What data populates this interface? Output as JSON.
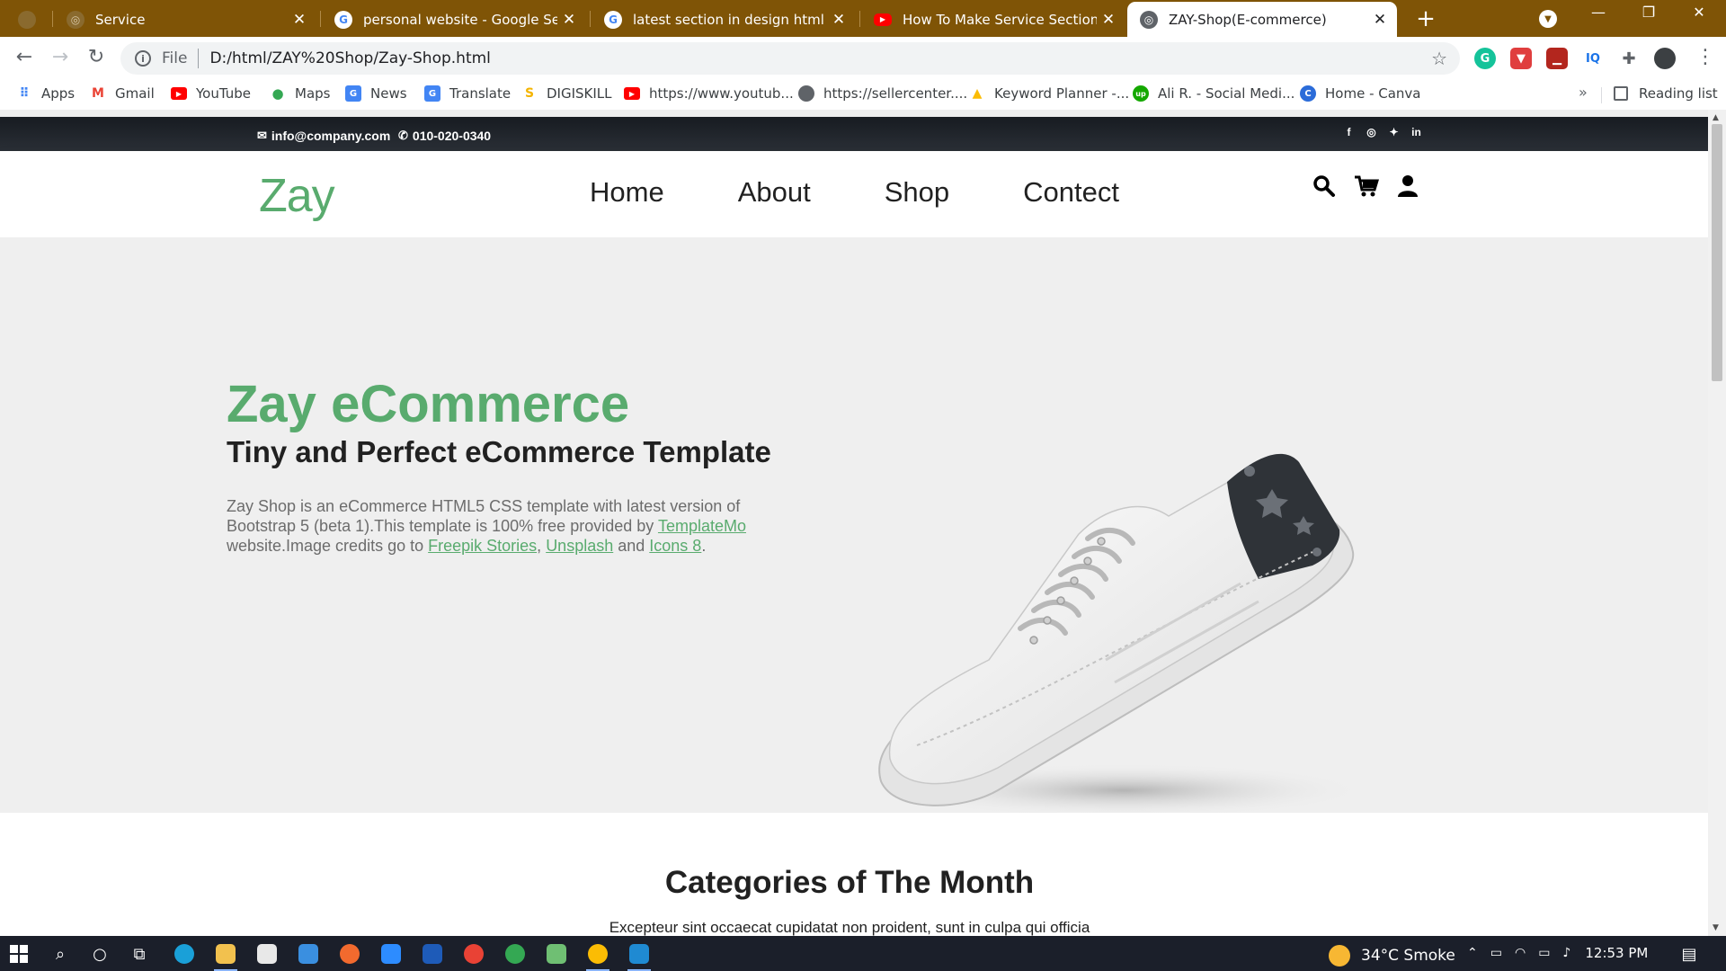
{
  "browser": {
    "tabs": [
      {
        "title": "Service",
        "icon": "globe-icon",
        "active": false
      },
      {
        "title": "personal website - Google Search",
        "icon": "google-icon",
        "active": false
      },
      {
        "title": "latest section in design html css",
        "icon": "google-icon",
        "active": false
      },
      {
        "title": "How To Make Service Section For",
        "icon": "youtube-icon",
        "active": false
      },
      {
        "title": "ZAY-Shop(E-commerce)",
        "icon": "globe-icon",
        "active": true
      }
    ],
    "address": {
      "scheme": "File",
      "url": "D:/html/ZAY%20Shop/Zay-Shop.html"
    },
    "bookmarks": [
      {
        "label": "Apps",
        "icon": "apps-grid-icon",
        "color": "#4285f4"
      },
      {
        "label": "Gmail",
        "icon": "gmail-icon",
        "color": "#ea4335"
      },
      {
        "label": "YouTube",
        "icon": "youtube-icon",
        "color": "#ff0000"
      },
      {
        "label": "Maps",
        "icon": "maps-pin-icon",
        "color": "#34a853"
      },
      {
        "label": "News",
        "icon": "news-icon",
        "color": "#4285f4"
      },
      {
        "label": "Translate",
        "icon": "translate-icon",
        "color": "#4285f4"
      },
      {
        "label": "DIGISKILL",
        "icon": "digiskill-icon",
        "color": "#f4b400"
      },
      {
        "label": "https://www.youtub...",
        "icon": "youtube-icon",
        "color": "#ff0000"
      },
      {
        "label": "https://sellercenter....",
        "icon": "globe-icon",
        "color": "#5f6368"
      },
      {
        "label": "Keyword Planner -...",
        "icon": "google-ads-icon",
        "color": "#fbbc04"
      },
      {
        "label": "Ali R. - Social Medi...",
        "icon": "upwork-icon",
        "color": "#14a800"
      },
      {
        "label": "Home - Canva",
        "icon": "canva-icon",
        "color": "#2b6cd9"
      }
    ],
    "reading_list": "Reading list"
  },
  "site": {
    "topbar": {
      "email": "info@company.com",
      "phone": "010-020-0340"
    },
    "logo": "Zay",
    "nav": [
      "Home",
      "About",
      "Shop",
      "Contect"
    ],
    "hero": {
      "title_bold": "Zay",
      "title_rest": " eCommerce",
      "subtitle": "Tiny and Perfect eCommerce Template",
      "text_1": "Zay Shop is an eCommerce HTML5 CSS template with latest version of Bootstrap 5 (beta 1).This template is 100% free provided by ",
      "link_templatemo": "TemplateMo",
      "text_2": " website.Image credits go to ",
      "link_freepik": "Freepik Stories",
      "comma": ", ",
      "link_unsplash": "Unsplash",
      "text_and": " and ",
      "link_icons8": "Icons 8",
      "text_end": "."
    },
    "categories": {
      "title": "Categories of The Month",
      "description": "Excepteur sint occaecat cupidatat non proident, sunt in culpa qui officia"
    },
    "accent_color": "#59ab6e"
  },
  "taskbar": {
    "weather": "34°C  Smoke",
    "time": "12:53 PM"
  }
}
